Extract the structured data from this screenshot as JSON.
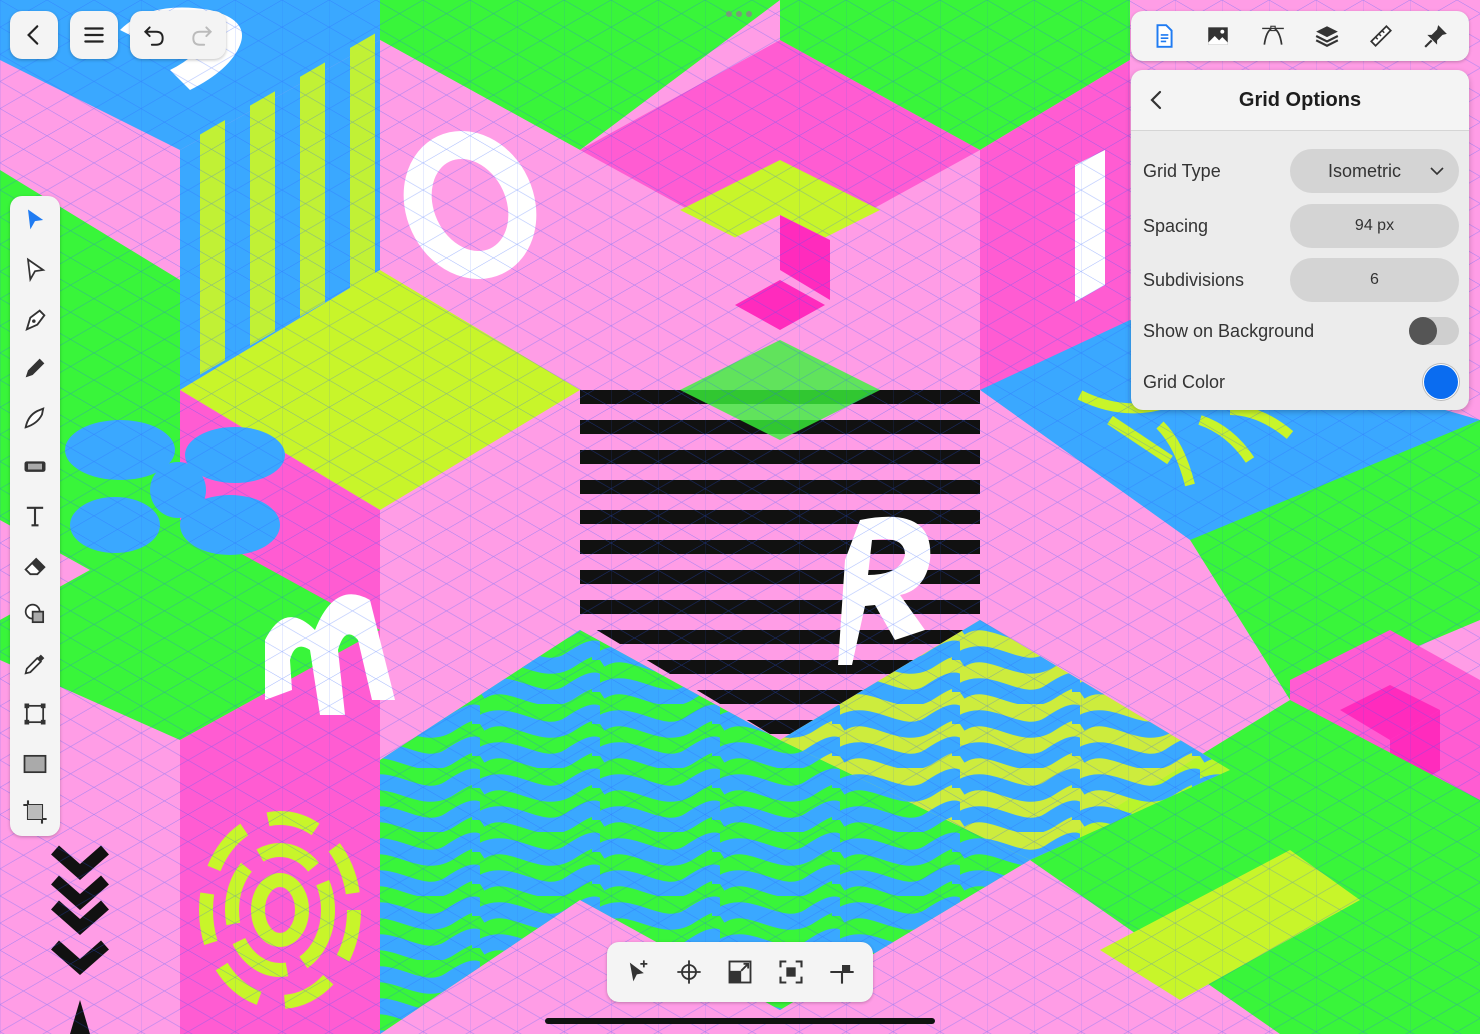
{
  "canvas": {
    "colors": {
      "pink": "#ff4fcf",
      "light_pink": "#ff9de6",
      "magenta": "#ff2bbd",
      "green": "#39f53a",
      "lime": "#c8f52a",
      "blue": "#3aa8ff",
      "black": "#111111",
      "white": "#ffffff"
    },
    "letters": [
      "O",
      "I",
      "m",
      "R"
    ]
  },
  "top_left": {
    "back_icon": "chevron-left-icon",
    "menu_icon": "hamburger-menu-icon",
    "undo_icon": "undo-icon",
    "redo_icon": "redo-icon"
  },
  "studio_tabs": [
    "document-icon",
    "image-icon",
    "node-tool-icon",
    "layers-icon",
    "ruler-icon",
    "pin-icon"
  ],
  "grid_options": {
    "title": "Grid Options",
    "rows": {
      "grid_type": {
        "label": "Grid Type",
        "value": "Isometric"
      },
      "spacing": {
        "label": "Spacing",
        "value": "94 px"
      },
      "subdivisions": {
        "label": "Subdivisions",
        "value": "6"
      },
      "show_on_background": {
        "label": "Show on Background",
        "on": false
      },
      "grid_color": {
        "label": "Grid Color",
        "color": "#0a6cf0"
      }
    }
  },
  "tools": [
    "move-tool-icon",
    "node-tool-icon",
    "pen-tool-icon",
    "pencil-tool-icon",
    "vector-brush-icon",
    "fill-tool-icon",
    "text-tool-icon",
    "eraser-icon",
    "shape-builder-icon",
    "color-picker-icon",
    "transform-tool-icon",
    "rectangle-tool-icon",
    "crop-tool-icon"
  ],
  "context_tools": [
    "add-selection-icon",
    "crosshair-icon",
    "scale-icon",
    "fit-icon",
    "snap-icon"
  ]
}
